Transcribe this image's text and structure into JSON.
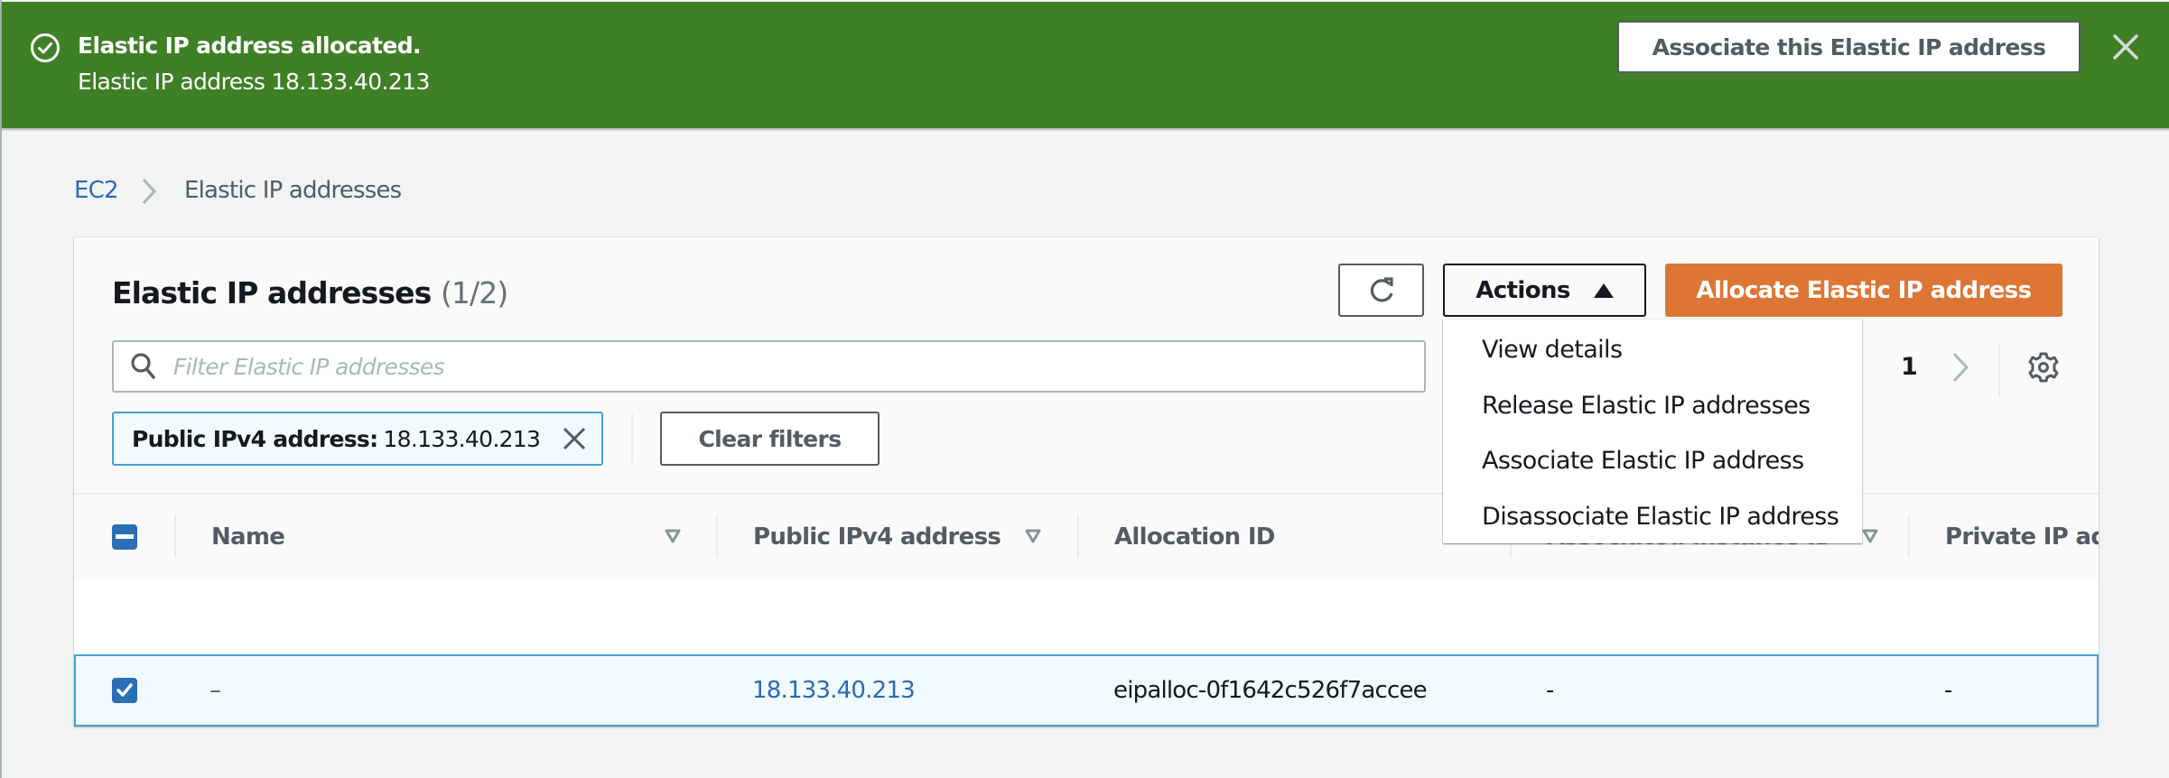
{
  "flash": {
    "type": "success",
    "title": "Elastic IP address allocated.",
    "message": "Elastic IP address 18.133.40.213",
    "action_label": "Associate this Elastic IP address",
    "icon": "check-circle-icon",
    "dismiss_icon": "close-icon",
    "color": "#3f7f26"
  },
  "breadcrumb": {
    "items": [
      {
        "label": "EC2",
        "link": true
      },
      {
        "label": "Elastic IP addresses",
        "link": false
      }
    ],
    "separator_icon": "chevron-right-icon"
  },
  "table_panel": {
    "title": "Elastic IP addresses",
    "count": "(1/2)",
    "refresh_icon": "refresh-icon",
    "actions_label": "Actions",
    "actions_expanded": true,
    "primary_label": "Allocate Elastic IP address",
    "primary_color": "#dd7634",
    "search": {
      "placeholder": "Filter Elastic IP addresses",
      "value": "",
      "icon": "search-icon"
    },
    "filter_token": {
      "key": "Public IPv4 address:",
      "value": "18.133.40.213"
    },
    "clear_filters_label": "Clear filters",
    "pagination": {
      "current_page": "1"
    },
    "settings_icon": "gear-icon"
  },
  "actions_menu": {
    "items": [
      {
        "label": "View details"
      },
      {
        "label": "Release Elastic IP addresses"
      },
      {
        "label": "Associate Elastic IP address"
      },
      {
        "label": "Disassociate Elastic IP address"
      }
    ]
  },
  "table": {
    "select_all_state": "indeterminate",
    "columns": [
      {
        "label": "Name",
        "sortable": true
      },
      {
        "label": "Public IPv4 address",
        "sortable": true
      },
      {
        "label": "Allocation ID",
        "sortable": true
      },
      {
        "label": "Associated instance ID",
        "sortable": true
      },
      {
        "label": "Private IP add",
        "sortable": false
      }
    ],
    "rows": [
      {
        "selected": true,
        "name": "–",
        "public_ipv4": "18.133.40.213",
        "allocation_id": "eipalloc-0f1642c526f7accee",
        "associated_instance_id": "-",
        "private_ip": "-"
      }
    ]
  }
}
